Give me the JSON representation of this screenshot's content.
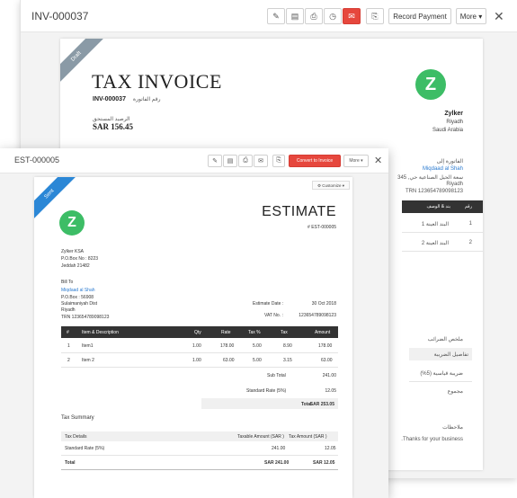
{
  "invoice_window": {
    "doc_id": "INV-000037",
    "record_payment": "Record Payment",
    "more": "More ▾",
    "ribbon": "Draft",
    "title": "TAX INVOICE",
    "number_label_ar": "رقم الفاتورة",
    "number": "INV-000037",
    "balance_label_ar": "الرصيد المستحق",
    "balance": "SAR 156.45",
    "company": "Zylker",
    "city": "Riyadh",
    "country": "Saudi Arabia",
    "bill_to_ar": "الفاتورة إلى",
    "customer": "Miqdaad al Shah",
    "addr_ar": "345 ,سعة الحيل الصناعية حي",
    "customer_city": "Riyadh",
    "trn": "TRN 123654789098123",
    "col_num_ar": "رقم",
    "col_item_ar": "بند & الوصف",
    "row1_num": "1",
    "row1_item_ar": "البند العينة 1",
    "row2_num": "2",
    "row2_item_ar": "البند العينة 2",
    "tax_summary_ar": "ملخص الضرائب",
    "tax_details_ar": "تفاصيل الضريبة",
    "vat_ar": "ضريبة قياسية (5%)",
    "total_ar": "مجموع",
    "notes_ar": "ملاحظات",
    "thanks": ".Thanks for your business"
  },
  "estimate_window": {
    "doc_id": "EST-000005",
    "convert_button": "Convert to Invoice",
    "more": "More ▾",
    "ribbon": "Sent",
    "customize": "⚙ Customize ▾",
    "logo_letter": "Z",
    "title": "ESTIMATE",
    "number": "# EST-000005",
    "company": "Zylker KSA",
    "po": "P.O.Box No : 8223",
    "city_zip": "Jeddah 21482",
    "bill_to": "Bill To",
    "customer": "Miqdaad al Shah",
    "cust_po": "P.O.Box : 56908",
    "cust_dist": "Sulaimaniyah Dist",
    "cust_city": "Riyadh",
    "cust_trn": "TRN 123654789098123",
    "estimate_date_label": "Estimate Date :",
    "estimate_date": "30 Oct 2018",
    "vat_label": "VAT No. :",
    "vat_no": "123654789098123",
    "table_headers": [
      "#",
      "Item & Description",
      "Qty",
      "Rate",
      "Tax %",
      "Tax",
      "Amount"
    ],
    "rows": [
      [
        "1",
        "Item1",
        "1.00",
        "178.00",
        "5.00",
        "8.90",
        "178.00"
      ],
      [
        "2",
        "Item 2",
        "1.00",
        "63.00",
        "5.00",
        "3.15",
        "63.00"
      ]
    ],
    "sub_total_label": "Sub Total",
    "sub_total": "241.00",
    "std_rate_label": "Standard Rate (5%)",
    "std_rate": "12.05",
    "total_label": "Total",
    "total": "SAR 253.05",
    "tax_summary_title": "Tax Summary",
    "tax_headers": [
      "Tax Details",
      "Taxable Amount (SAR )",
      "Tax Amount (SAR )"
    ],
    "tax_row": [
      "Standard Rate (5%)",
      "241.00",
      "12.05"
    ],
    "tax_total": [
      "Total",
      "SAR 241.00",
      "SAR 12.05"
    ]
  },
  "invoice_logo_letter": "Z",
  "colors": {
    "accent_red": "#e6473d",
    "green_logo": "#3dbd66",
    "link_blue": "#2b7bd0"
  }
}
